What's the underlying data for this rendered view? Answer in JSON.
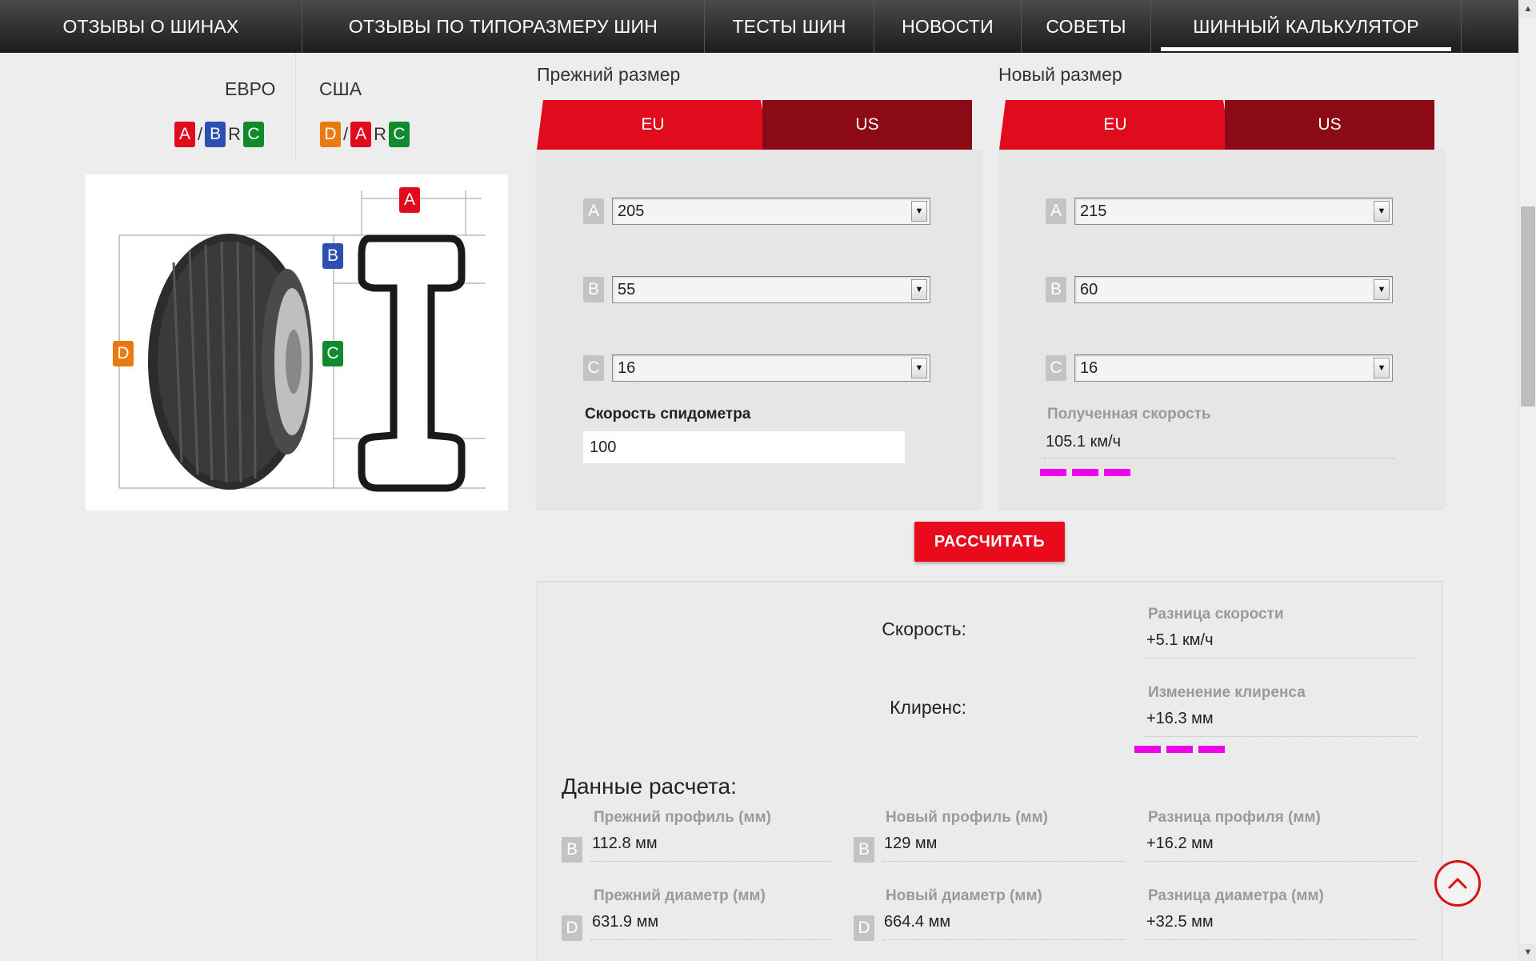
{
  "nav": {
    "items": [
      "ОТЗЫВЫ О ШИНАХ",
      "ОТЗЫВЫ ПО ТИПОРАЗМЕРУ ШИН",
      "ТЕСТЫ ШИН",
      "НОВОСТИ",
      "СОВЕТЫ",
      "ШИННЫЙ КАЛЬКУЛЯТОР"
    ],
    "active": "ШИННЫЙ КАЛЬКУЛЯТОР"
  },
  "legend": {
    "euro_title": "ЕВРО",
    "usa_title": "США",
    "euro_format": [
      "A",
      "/",
      "B",
      "R",
      "C"
    ],
    "usa_format": [
      "D",
      "/",
      "A",
      "R",
      "C"
    ]
  },
  "diagram": {
    "labels": [
      "A",
      "B",
      "C",
      "D"
    ]
  },
  "old_size": {
    "title": "Прежний размер",
    "tab_eu": "EU",
    "tab_us": "US",
    "fields": [
      {
        "label": "A",
        "value": "205"
      },
      {
        "label": "B",
        "value": "55"
      },
      {
        "label": "C",
        "value": "16"
      }
    ],
    "speed_label": "Скорость спидометра",
    "speed_value": "100"
  },
  "new_size": {
    "title": "Новый размер",
    "tab_eu": "EU",
    "tab_us": "US",
    "fields": [
      {
        "label": "A",
        "value": "215"
      },
      {
        "label": "B",
        "value": "60"
      },
      {
        "label": "C",
        "value": "16"
      }
    ],
    "result_label": "Полученная скорость",
    "result_value": "105.1 км/ч"
  },
  "calculate_button": "РАССЧИТАТЬ",
  "results": {
    "speed_name": "Скорость:",
    "speed_caption": "Разница скорости",
    "speed_value": "+5.1 км/ч",
    "clearance_name": "Клиренс:",
    "clearance_caption": "Изменение клиренса",
    "clearance_value": "+16.3 мм",
    "heading": "Данные расчета:",
    "old_profile_caption": "Прежний профиль (мм)",
    "old_profile_label": "B",
    "old_profile_value": "112.8 мм",
    "new_profile_caption": "Новый профиль (мм)",
    "new_profile_label": "B",
    "new_profile_value": "129 мм",
    "profile_diff_caption": "Разница профиля (мм)",
    "profile_diff_value": "+16.2 мм",
    "old_diameter_caption": "Прежний диаметр (мм)",
    "old_diameter_label": "D",
    "old_diameter_value": "631.9 мм",
    "new_diameter_caption": "Новый диаметр (мм)",
    "new_diameter_label": "D",
    "new_diameter_value": "664.4 мм",
    "diameter_diff_caption": "Разница диаметра (мм)",
    "diameter_diff_value": "+32.5 мм"
  },
  "colors": {
    "nav_bg": "#2a2a2a",
    "accent_red": "#e00b1c",
    "tab_dark": "#8c0a16",
    "marker_magenta": "#ee00ee"
  },
  "icons": [
    "arrow-up-icon",
    "dropdown-arrow-icon",
    "scroll-up-icon",
    "scroll-down-icon"
  ]
}
